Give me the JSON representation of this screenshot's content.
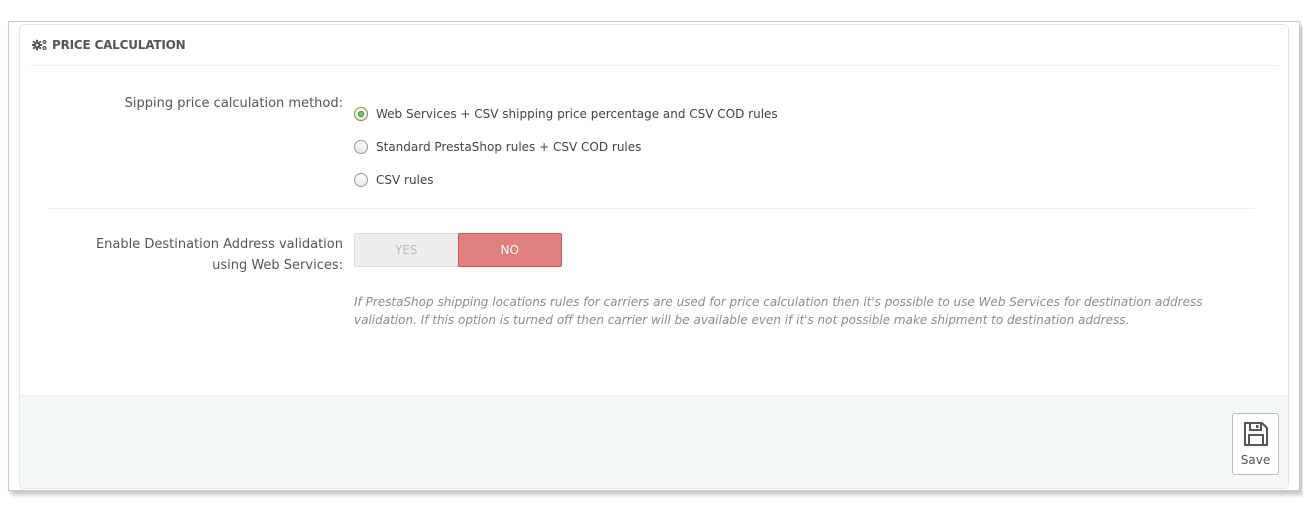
{
  "panel": {
    "title": "PRICE CALCULATION",
    "title_icon": "cogs-icon"
  },
  "price_method": {
    "label": "Sipping price calculation method:",
    "selected_index": 0,
    "options": [
      {
        "label": "Web Services + CSV shipping price percentage and CSV COD rules",
        "checked": true
      },
      {
        "label": "Standard PrestaShop rules + CSV COD rules",
        "checked": false
      },
      {
        "label": "CSV rules",
        "checked": false
      }
    ]
  },
  "address_validation": {
    "label_line1": "Enable Destination Address validation",
    "label_line2": "using Web Services:",
    "yes_label": "YES",
    "no_label": "NO",
    "selected": "NO",
    "help_text": "If PrestaShop shipping locations rules for carriers are used for price calculation then it's possible to use Web Services for destination address validation. If this option is turned off then carrier will be available even if it's not possible make shipment to destination address."
  },
  "footer": {
    "save_label": "Save",
    "save_icon": "floppy-disk-icon"
  },
  "colors": {
    "no_active": "#e08080",
    "radio_checked": "#72c279",
    "footer_bg": "#f5f8f9"
  }
}
